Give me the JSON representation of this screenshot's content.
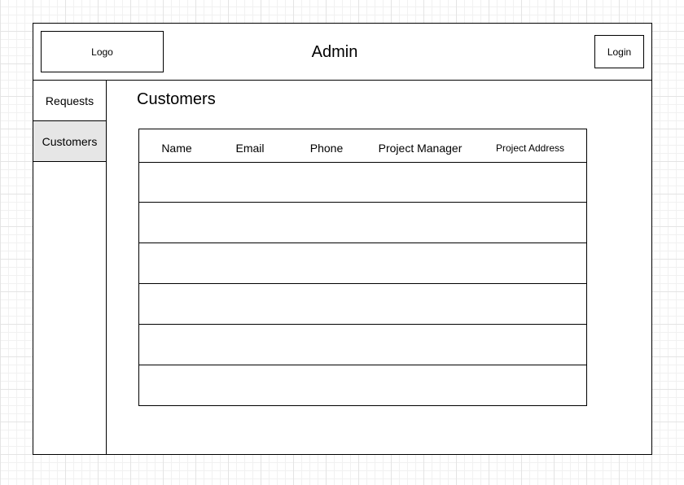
{
  "header": {
    "logo_text": "Logo",
    "app_title": "Admin",
    "login_label": "Login"
  },
  "sidebar": {
    "items": [
      {
        "label": "Requests",
        "selected": false
      },
      {
        "label": "Customers",
        "selected": true
      }
    ]
  },
  "main": {
    "title": "Customers",
    "table": {
      "columns": [
        "Name",
        "Email",
        "Phone",
        "Project Manager",
        "Project Address"
      ],
      "row_count": 6
    }
  },
  "colors": {
    "selected_nav_bg": "#e6e6e6",
    "border": "#000000",
    "grid_line": "#e4e4e4"
  }
}
